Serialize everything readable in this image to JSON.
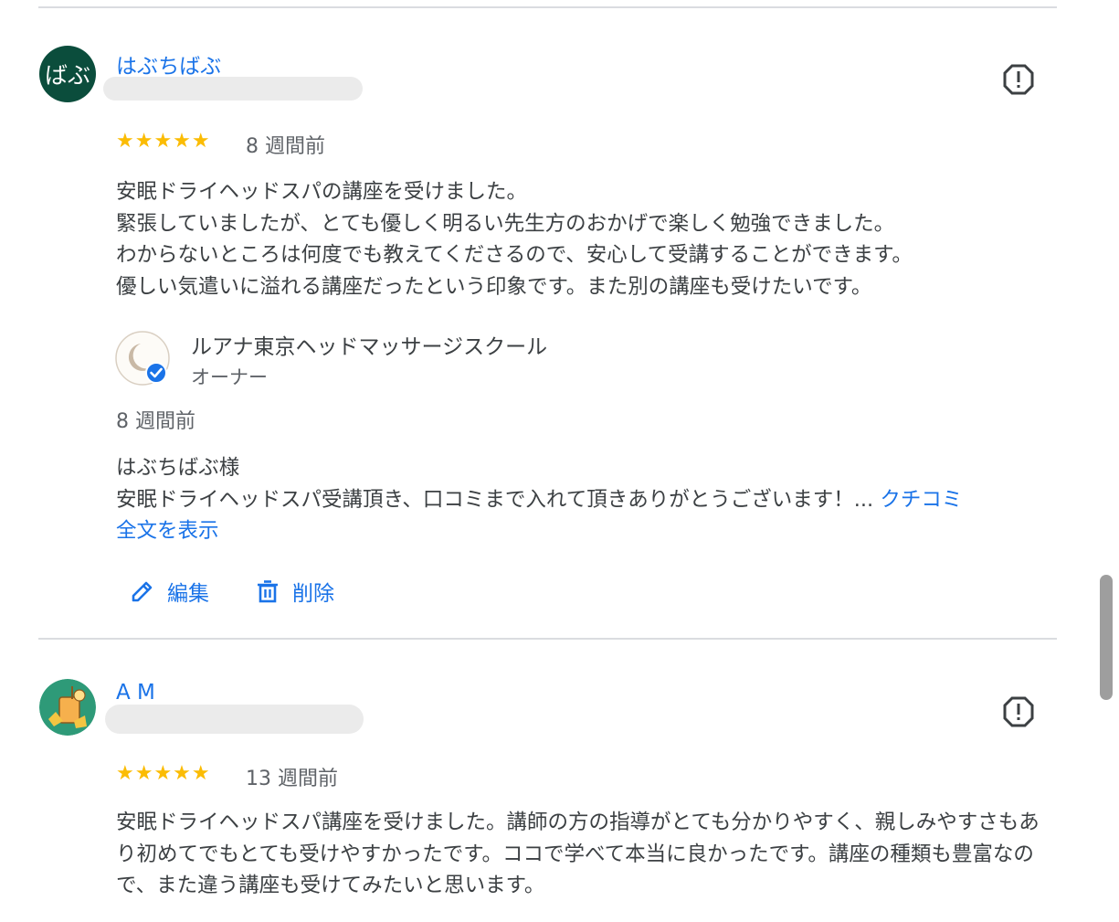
{
  "reviews": [
    {
      "avatar_text": "ばぶ",
      "avatar_color": "#0b4d3c",
      "name": "はぶちばぶ",
      "rating": "★★★★★",
      "time": "8 週間前",
      "lines": [
        "安眠ドライヘッドスパの講座を受けました。",
        "緊張していましたが、とても優しく明るい先生方のおかげで楽しく勉強できました。",
        "わからないところは何度でも教えてくださるので、安心して受講することができます。",
        "優しい気遣いに溢れる講座だったという印象です。また別の講座も受けたいです。"
      ],
      "owner": {
        "name": "ルアナ東京ヘッドマッサージスクール",
        "role": "オーナー",
        "time": "8 週間前",
        "greeting": "はぶちばぶ様",
        "reply_preview": "安眠ドライヘッドスパ受講頂き、口コミまで入れて頂きありがとうございます！...",
        "show_more_1": "クチコミ",
        "show_more_2": "全文を表示"
      },
      "actions": {
        "edit": "編集",
        "delete": "削除"
      }
    },
    {
      "avatar_color": "#2e9a78",
      "name": "A M",
      "rating": "★★★★★",
      "time": "13 週間前",
      "text": "安眠ドライヘッドスパ講座を受けました。講師の方の指導がとても分かりやすく、親しみやすさもあり初めてでもとても受けやすかったです。ココで学べて本当に良かったです。講座の種類も豊富なので、また違う講座も受けてみたいと思います。"
    }
  ],
  "colors": {
    "link": "#1a73e8",
    "star": "#fbbc04",
    "text": "#3c4043",
    "divider": "#dadce0"
  }
}
